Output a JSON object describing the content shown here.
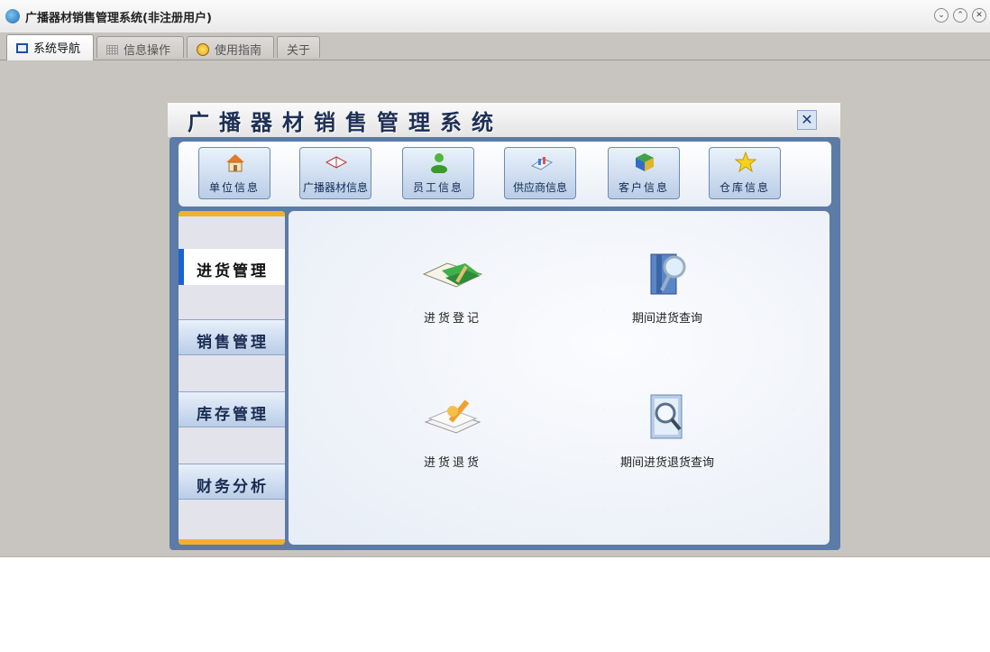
{
  "window": {
    "title": "广播器材销售管理系统(非注册用户)",
    "controls": [
      "minimize",
      "maximize",
      "close"
    ]
  },
  "tabs": [
    {
      "label": "系统导航",
      "icon": "screen-icon",
      "active": true
    },
    {
      "label": "信息操作",
      "icon": "grid-icon",
      "active": false
    },
    {
      "label": "使用指南",
      "icon": "help-icon",
      "active": false
    },
    {
      "label": "关于",
      "icon": "",
      "active": false
    }
  ],
  "panel": {
    "title": "广播器材销售管理系统",
    "close_icon": "close-icon"
  },
  "toolbar": [
    {
      "label": "单位信息",
      "icon": "house-icon"
    },
    {
      "label": "广播器材信息",
      "icon": "book-icon"
    },
    {
      "label": "员工信息",
      "icon": "person-icon"
    },
    {
      "label": "供应商信息",
      "icon": "chart-icon"
    },
    {
      "label": "客户信息",
      "icon": "cube-icon"
    },
    {
      "label": "仓库信息",
      "icon": "star-icon"
    }
  ],
  "sidebar": [
    {
      "label": "进货管理",
      "active": true
    },
    {
      "label": "销售管理",
      "active": false
    },
    {
      "label": "库存管理",
      "active": false
    },
    {
      "label": "财务分析",
      "active": false
    }
  ],
  "actions": [
    {
      "label": "进货登记",
      "icon": "books-icon"
    },
    {
      "label": "期间进货查询",
      "icon": "book-search-icon"
    },
    {
      "label": "进货退货",
      "icon": "pen-paper-icon"
    },
    {
      "label": "期间进货退货查询",
      "icon": "document-search-icon"
    }
  ],
  "colors": {
    "accent_blue": "#1b63d3",
    "sidebar_highlight": "#f3b02d",
    "frame": "#5c7ba6"
  }
}
